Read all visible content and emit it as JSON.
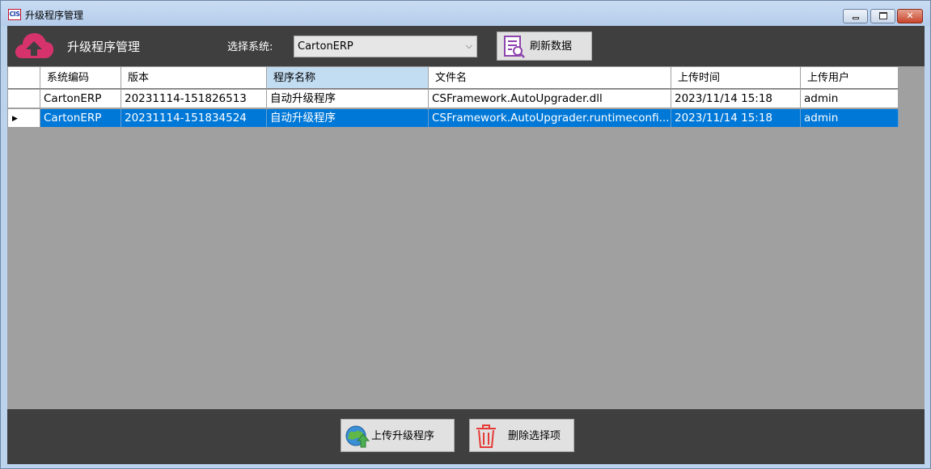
{
  "window": {
    "icon_text": "CIS",
    "title": "升级程序管理"
  },
  "header": {
    "app_title": "升级程序管理",
    "system_label": "选择系统:",
    "system_value": "CartonERP",
    "refresh_label": "刷新数据"
  },
  "grid": {
    "columns": [
      "系统编码",
      "版本",
      "程序名称",
      "文件名",
      "上传时间",
      "上传用户"
    ],
    "sorted_column": "程序名称",
    "rows": [
      {
        "system_code": "CartonERP",
        "version": "20231114-151826513",
        "program_name": "自动升级程序",
        "file_name": "CSFramework.AutoUpgrader.dll",
        "upload_time": "2023/11/14 15:18",
        "upload_user": "admin"
      },
      {
        "system_code": "CartonERP",
        "version": "20231114-151834524",
        "program_name": "自动升级程序",
        "file_name": "CSFramework.AutoUpgrader.runtimeconfi...",
        "upload_time": "2023/11/14 15:18",
        "upload_user": "admin",
        "selected": true
      }
    ]
  },
  "footer": {
    "upload_label": "上传升级程序",
    "delete_label": "删除选择项"
  },
  "colors": {
    "toolbar_bg": "#3f3f3f",
    "grid_bg": "#a0a0a0",
    "selection": "#0078d7",
    "cloud_icon": "#d6336c",
    "refresh_icon": "#8e44ad",
    "delete_icon": "#e53935"
  }
}
